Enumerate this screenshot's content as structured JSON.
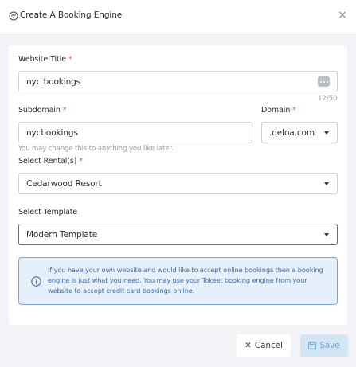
{
  "dialog": {
    "title": "Create A Booking Engine",
    "close_symbol": "×"
  },
  "form": {
    "website_title": {
      "label": "Website Title",
      "required_mark": "*",
      "value": "nyc bookings",
      "counter": "12/50"
    },
    "subdomain": {
      "label": "Subdomain",
      "required_mark": "*",
      "value": "nycbookings",
      "helper": "You may change this to anything you like later."
    },
    "domain": {
      "label": "Domain",
      "required_mark": "*",
      "value": ".qeloa.com"
    },
    "rental": {
      "label": "Select Rental(s)",
      "required_mark": "*",
      "value": "Cedarwood Resort"
    },
    "template": {
      "label": "Select Template",
      "value": "Modern Template"
    }
  },
  "info": {
    "text": "If you have your own website and would like to accept online bookings then a booking engine is just what you need. You may use your Tokeet booking engine from your website to accept credit card bookings online."
  },
  "footer": {
    "cancel_label": "Cancel",
    "save_label": "Save"
  },
  "colors": {
    "accent": "#2a8a7a",
    "required": "#e5484d",
    "info_bg": "#e6f0fa",
    "info_border": "#7aa6d6",
    "save_bg": "#d3e6f6"
  },
  "icons": [
    "booking-engine-icon",
    "close-icon",
    "dots-icon",
    "chevron-down-icon",
    "info-icon",
    "cancel-x-icon",
    "save-icon"
  ]
}
